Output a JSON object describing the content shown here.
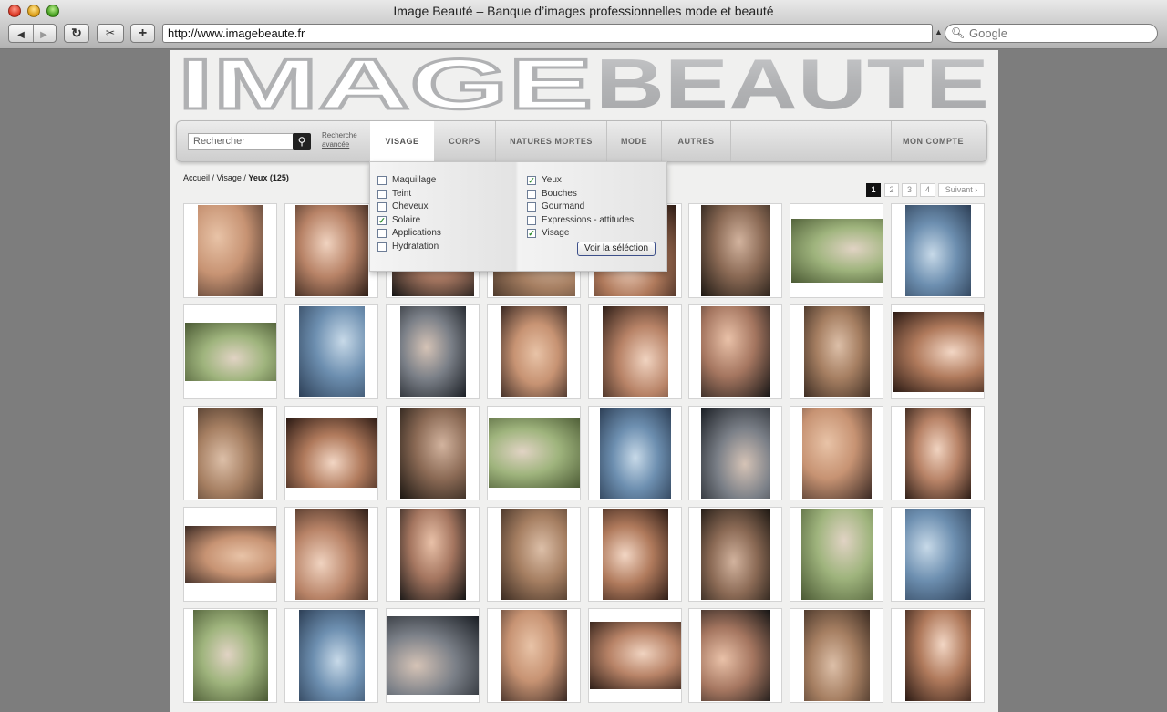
{
  "window": {
    "title": "Image Beauté – Banque d’images professionnelles mode et beauté"
  },
  "browser": {
    "url": "http://www.imagebeaute.fr",
    "search_placeholder": "Google",
    "reload_icon": "↻",
    "snap_icon": "✂",
    "add_icon": "+",
    "back_icon": "◀",
    "forward_icon": "▶"
  },
  "logo": {
    "part1": "IMAGE",
    "part2": "BEAUTE"
  },
  "search": {
    "placeholder": "Rechercher",
    "advanced_line1": "Recherche",
    "advanced_line2": "avancée"
  },
  "nav": {
    "tabs": [
      "VISAGE",
      "CORPS",
      "NATURES MORTES",
      "MODE",
      "AUTRES"
    ],
    "account": "MON COMPTE"
  },
  "breadcrumb": {
    "home": "Accueil",
    "sep": " / ",
    "section": "Visage",
    "current": "Yeux (125)"
  },
  "pagination": {
    "pages": [
      "1",
      "2",
      "3",
      "4"
    ],
    "next": "Suivant ›",
    "current": "1"
  },
  "dropdown": {
    "left": [
      {
        "label": "Maquillage",
        "checked": false
      },
      {
        "label": "Teint",
        "checked": false
      },
      {
        "label": "Cheveux",
        "checked": false
      },
      {
        "label": "Solaire",
        "checked": true
      },
      {
        "label": "Applications",
        "checked": false
      },
      {
        "label": "Hydratation",
        "checked": false
      }
    ],
    "right": [
      {
        "label": "Yeux",
        "checked": true
      },
      {
        "label": "Bouches",
        "checked": false
      },
      {
        "label": "Gourmand",
        "checked": false
      },
      {
        "label": "Expressions - attitudes",
        "checked": false
      },
      {
        "label": "Visage",
        "checked": true
      }
    ],
    "button": "Voir la séléction",
    "check_mark": "✓"
  },
  "colors": {
    "logo_grey": "#b5b6b8",
    "skin": "#d7a98c",
    "green": "#4f8f5a",
    "blue": "#2e6cb3"
  }
}
